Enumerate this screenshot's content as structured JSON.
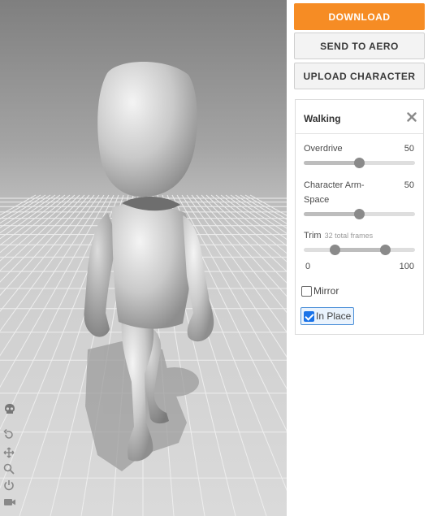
{
  "viewport": {
    "toolbar_icons": [
      "skull-icon",
      "undo-icon",
      "move-icon",
      "zoom-icon",
      "power-icon",
      "camera-icon"
    ]
  },
  "actions": {
    "download_label": "DOWNLOAD",
    "send_label": "SEND TO AERO",
    "upload_label": "UPLOAD CHARACTER"
  },
  "animation": {
    "title": "Walking",
    "overdrive": {
      "label": "Overdrive",
      "value": "50",
      "level": 0.5
    },
    "arm_space": {
      "label_line1": "Character Arm-",
      "label_line2": "Space",
      "value": "50",
      "level": 0.5
    },
    "trim": {
      "label": "Trim",
      "note": "32 total frames",
      "min_label": "0",
      "max_label": "100",
      "start": 0.28,
      "end": 0.73
    },
    "mirror": {
      "label": "Mirror",
      "checked": false
    },
    "in_place": {
      "label": "In Place",
      "checked": true
    }
  },
  "colors": {
    "primary": "#f68c24",
    "accent": "#1a73e8"
  }
}
